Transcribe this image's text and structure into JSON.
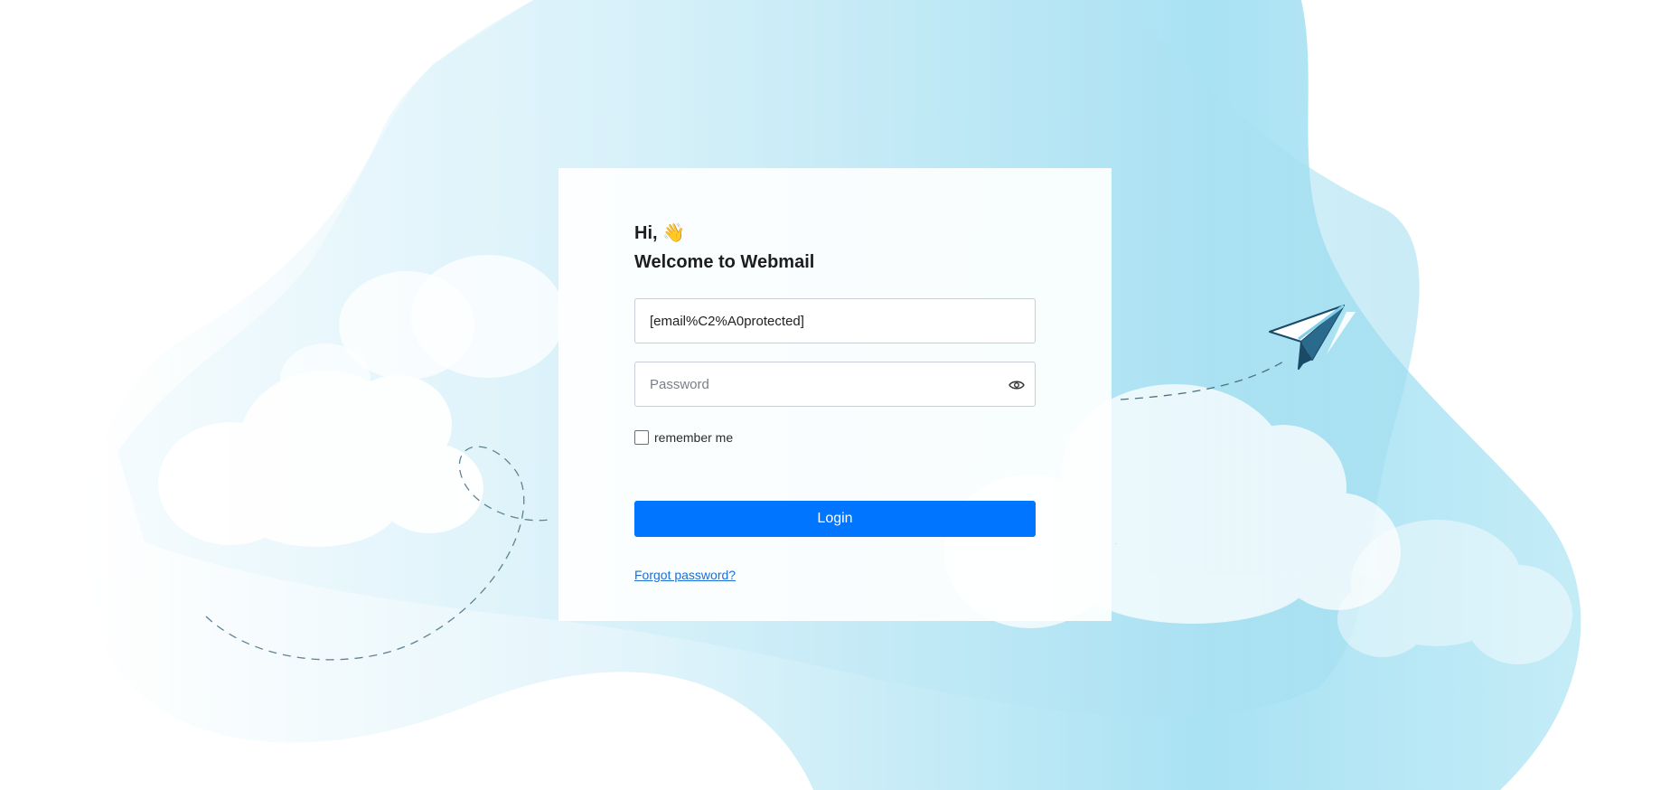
{
  "login": {
    "greeting": "Hi, 👋",
    "welcome_title": "Welcome to Webmail",
    "email_value": "[email%C2%A0protected]",
    "password_placeholder": "Password",
    "remember_label": "remember me",
    "login_label": "Login",
    "forgot_label": "Forgot password?"
  },
  "icons": {
    "password_toggle": "eye-icon",
    "illustration": "paper-plane-icon"
  },
  "colors": {
    "accent": "#0075ff",
    "link": "#1a6fd6",
    "background_blob": "#a9e1f2"
  }
}
